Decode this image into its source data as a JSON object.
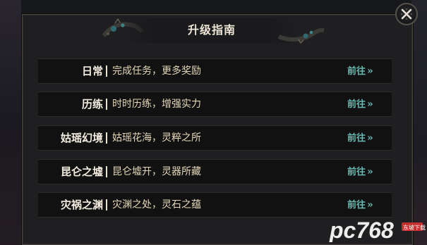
{
  "dialog": {
    "title": "升级指南",
    "close_icon": "close-icon"
  },
  "rows": [
    {
      "name": "日常",
      "desc": "完成任务，更多奖励",
      "go": "前往"
    },
    {
      "name": "历练",
      "desc": "时时历练，增强实力",
      "go": "前往"
    },
    {
      "name": "姑瑶幻境",
      "desc": "姑瑶花海，灵粹之所",
      "go": "前往"
    },
    {
      "name": "昆仑之墟",
      "desc": "昆仑墟开，灵器所藏",
      "go": "前往"
    },
    {
      "name": "灾祸之渊",
      "desc": "灾渊之处，灵石之蕴",
      "go": "前往"
    }
  ],
  "go_icon": "double-chevron-right-icon",
  "watermark": {
    "logo": "pc768",
    "sub": "东坡下载"
  },
  "colors": {
    "go_text": "#6bb8b0",
    "desc_text": "#e4d8b8",
    "name_text": "#f3ede0"
  }
}
